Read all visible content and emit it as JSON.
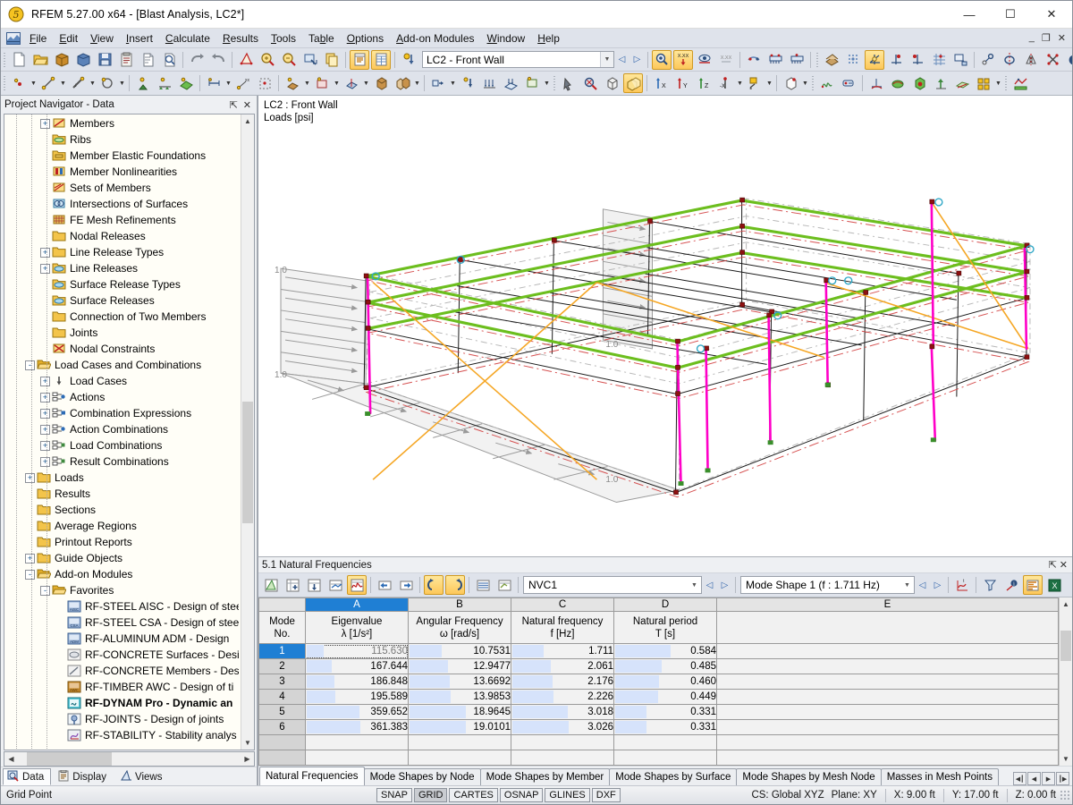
{
  "window": {
    "title": "RFEM 5.27.00 x64 - [Blast Analysis, LC2*]",
    "app_icon": "rfem-logo-icon",
    "minimize": "—",
    "maximize": "☐",
    "close": "✕",
    "mdi_minimize": "_",
    "mdi_restore": "❐",
    "mdi_close": "✕"
  },
  "menu": {
    "items": [
      {
        "label": "File",
        "mnemonic": "F"
      },
      {
        "label": "Edit",
        "mnemonic": "E"
      },
      {
        "label": "View",
        "mnemonic": "V"
      },
      {
        "label": "Insert",
        "mnemonic": "I"
      },
      {
        "label": "Calculate",
        "mnemonic": "C"
      },
      {
        "label": "Results",
        "mnemonic": "R"
      },
      {
        "label": "Tools",
        "mnemonic": "T"
      },
      {
        "label": "Table",
        "mnemonic": "b"
      },
      {
        "label": "Options",
        "mnemonic": "O"
      },
      {
        "label": "Add-on Modules",
        "mnemonic": "A"
      },
      {
        "label": "Window",
        "mnemonic": "W"
      },
      {
        "label": "Help",
        "mnemonic": "H"
      }
    ]
  },
  "toolbar_main": {
    "load_case_value": "LC2 - Front Wall",
    "load_case_placeholder": "Load case",
    "buttons": [
      "new-file-icon",
      "open-file-icon",
      "open-project-icon",
      "save-project-icon",
      "save-icon",
      "clipboard-icon",
      "print-preview-icon",
      "print-icon",
      "undo-icon",
      "redo-icon",
      "render-model-icon",
      "zoom-in-icon",
      "zoom-out-icon",
      "zoom-window-icon",
      "copy-icon",
      "table-display-icon",
      "table-grid-icon",
      "load-case-icon"
    ],
    "nav_prev": "◁",
    "nav_next": "▷",
    "right_buttons": [
      "show-support-icon",
      "show-loads-icon",
      "show-eye-icon",
      "show-values-icon",
      "member-hinge-icon",
      "support-view-1-icon",
      "support-view-2-icon",
      "render-surface-icon",
      "mesh-points-icon",
      "global-axes-icon",
      "axis-x-icon",
      "axis-y-icon",
      "mesh-grid-icon",
      "print-view-icon",
      "node-snap-icon",
      "rotate-icon",
      "mirror-icon",
      "delete-cross-icon",
      "info-icon",
      "measure-icon",
      "xls-export-icon"
    ]
  },
  "toolbar_second": {
    "buttons": [
      "node-icon",
      "line-icon",
      "member-icon",
      "opening-icon",
      "support-node-icon",
      "support-line-icon",
      "surface-icon",
      "dimension-icon",
      "text-icon",
      "select-region-icon",
      "solid-icon",
      "opening-2-icon",
      "cutting-plane-icon",
      "block-icon",
      "copy-block-icon",
      "result-beam-icon",
      "nodal-load-icon",
      "line-load-icon",
      "surface-load-icon",
      "free-load-icon",
      "imperfection-icon",
      "select-special-icon",
      "zoom-all-icon",
      "zoom-detail-icon",
      "view-box-icon",
      "view-3d-icon",
      "view-x-icon",
      "view-y-icon",
      "view-z-icon",
      "view-negx-icon",
      "render-mode-icon",
      "clipping-box-icon",
      "graph-icon",
      "results-table-icon",
      "deformation-icon",
      "surface-result-icon",
      "solid-result-icon",
      "member-result-icon",
      "smoothing-icon",
      "multi-window-icon",
      "result-diagram-icon"
    ]
  },
  "navigator": {
    "title": "Project Navigator - Data",
    "pin_icon": "pin-icon",
    "close_icon": "close-icon",
    "tree": [
      {
        "label": "Members",
        "icon": "members-icon",
        "indent": 3,
        "expander": "+"
      },
      {
        "label": "Ribs",
        "icon": "ribs-icon",
        "indent": 3,
        "expander": ""
      },
      {
        "label": "Member Elastic Foundations",
        "icon": "foundation-icon",
        "indent": 3,
        "expander": ""
      },
      {
        "label": "Member Nonlinearities",
        "icon": "nonlinearity-icon",
        "indent": 3,
        "expander": ""
      },
      {
        "label": "Sets of Members",
        "icon": "sets-icon",
        "indent": 3,
        "expander": ""
      },
      {
        "label": "Intersections of Surfaces",
        "icon": "intersections-icon",
        "indent": 3,
        "expander": ""
      },
      {
        "label": "FE Mesh Refinements",
        "icon": "mesh-refine-icon",
        "indent": 3,
        "expander": ""
      },
      {
        "label": "Nodal Releases",
        "icon": "folder-icon",
        "indent": 3,
        "expander": ""
      },
      {
        "label": "Line Release Types",
        "icon": "folder-icon",
        "indent": 3,
        "expander": "+"
      },
      {
        "label": "Line Releases",
        "icon": "folder-green-icon",
        "indent": 3,
        "expander": "+"
      },
      {
        "label": "Surface Release Types",
        "icon": "folder-green-icon",
        "indent": 3,
        "expander": ""
      },
      {
        "label": "Surface Releases",
        "icon": "folder-green-icon",
        "indent": 3,
        "expander": ""
      },
      {
        "label": "Connection of Two Members",
        "icon": "folder-icon",
        "indent": 3,
        "expander": ""
      },
      {
        "label": "Joints",
        "icon": "folder-icon",
        "indent": 3,
        "expander": ""
      },
      {
        "label": "Nodal Constraints",
        "icon": "constraints-icon",
        "indent": 3,
        "expander": ""
      },
      {
        "label": "Load Cases and Combinations",
        "icon": "folder-open-icon",
        "indent": 2,
        "expander": "-"
      },
      {
        "label": "Load Cases",
        "icon": "loadcase-icon",
        "indent": 3,
        "expander": "+"
      },
      {
        "label": "Actions",
        "icon": "action-icon",
        "indent": 3,
        "expander": "+"
      },
      {
        "label": "Combination Expressions",
        "icon": "comb-expr-icon",
        "indent": 3,
        "expander": "+"
      },
      {
        "label": "Action Combinations",
        "icon": "action-comb-icon",
        "indent": 3,
        "expander": "+"
      },
      {
        "label": "Load Combinations",
        "icon": "load-comb-icon",
        "indent": 3,
        "expander": "+"
      },
      {
        "label": "Result Combinations",
        "icon": "result-comb-icon",
        "indent": 3,
        "expander": "+"
      },
      {
        "label": "Loads",
        "icon": "folder-icon",
        "indent": 2,
        "expander": "+"
      },
      {
        "label": "Results",
        "icon": "folder-icon",
        "indent": 2,
        "expander": ""
      },
      {
        "label": "Sections",
        "icon": "folder-icon",
        "indent": 2,
        "expander": ""
      },
      {
        "label": "Average Regions",
        "icon": "folder-icon",
        "indent": 2,
        "expander": ""
      },
      {
        "label": "Printout Reports",
        "icon": "folder-icon",
        "indent": 2,
        "expander": ""
      },
      {
        "label": "Guide Objects",
        "icon": "folder-icon",
        "indent": 2,
        "expander": "+"
      },
      {
        "label": "Add-on Modules",
        "icon": "folder-open-icon",
        "indent": 2,
        "expander": "-"
      },
      {
        "label": "Favorites",
        "icon": "folder-open-icon",
        "indent": 3,
        "expander": "-"
      },
      {
        "label": "RF-STEEL AISC - Design of stee",
        "icon": "aisc-icon",
        "indent": 4,
        "expander": ""
      },
      {
        "label": "RF-STEEL CSA - Design of steel",
        "icon": "csa-icon",
        "indent": 4,
        "expander": ""
      },
      {
        "label": "RF-ALUMINUM ADM - Design",
        "icon": "adm-icon",
        "indent": 4,
        "expander": ""
      },
      {
        "label": "RF-CONCRETE Surfaces - Desig",
        "icon": "concrete-surf-icon",
        "indent": 4,
        "expander": ""
      },
      {
        "label": "RF-CONCRETE Members - Des",
        "icon": "concrete-mem-icon",
        "indent": 4,
        "expander": ""
      },
      {
        "label": "RF-TIMBER AWC - Design of ti",
        "icon": "awc-icon",
        "indent": 4,
        "expander": ""
      },
      {
        "label": "RF-DYNAM Pro - Dynamic an",
        "icon": "dynam-icon",
        "indent": 4,
        "expander": "",
        "bold": true
      },
      {
        "label": "RF-JOINTS - Design of joints",
        "icon": "joints-icon",
        "indent": 4,
        "expander": ""
      },
      {
        "label": "RF-STABILITY - Stability analys",
        "icon": "stability-icon",
        "indent": 4,
        "expander": ""
      }
    ],
    "tabs": [
      {
        "label": "Data",
        "icon": "data-icon",
        "selected": true
      },
      {
        "label": "Display",
        "icon": "display-icon",
        "selected": false
      },
      {
        "label": "Views",
        "icon": "views-icon",
        "selected": false
      }
    ]
  },
  "viewport": {
    "label_line1": "LC2 : Front Wall",
    "label_line2": "Loads [psi]",
    "load_values": [
      "1.0",
      "1.0",
      "1.0",
      "1.0"
    ],
    "colors": {
      "green_beam": "#6cbe1e",
      "magenta_member": "#ff00c8",
      "orange_brace": "#f5a623",
      "node_red": "#8e1010",
      "load_gray": "#9a9a9a",
      "surface_fill": "#eeeeee"
    }
  },
  "table_panel": {
    "title": "5.1 Natural Frequencies",
    "pin_icon": "pin-icon",
    "close_icon": "close-icon",
    "toolbar_buttons": [
      "table-filter-icon",
      "table-insert-icon",
      "table-import-icon",
      "table-edit-icon",
      "table-chart-icon",
      "table-prev-icon",
      "table-next-icon",
      "table-undo-icon",
      "table-redo-icon",
      "table-view-icon",
      "table-print-icon"
    ],
    "toolbar_right_buttons": [
      "table-graph-icon",
      "table-filter2-icon",
      "table-info-icon",
      "table-color-icon",
      "table-excel-icon"
    ],
    "combo_loadcase": "NVC1",
    "combo_loadcase_placeholder": "Load case",
    "combo_modeshape": "Mode Shape 1 (f : 1.711 Hz)",
    "combo_modeshape_placeholder": "Mode shape",
    "nav_prev": "◁",
    "nav_next": "▷",
    "row_header_label_line1": "Mode",
    "row_header_label_line2": "No.",
    "column_letters": [
      "A",
      "B",
      "C",
      "D",
      "E"
    ],
    "selected_column": "A",
    "columns": [
      {
        "title": "Eigenvalue",
        "unit": "λ [1/s²]"
      },
      {
        "title": "Angular Frequency",
        "unit": "ω [rad/s]"
      },
      {
        "title": "Natural frequency",
        "unit": "f [Hz]"
      },
      {
        "title": "Natural period",
        "unit": "T [s]"
      },
      {
        "title": "",
        "unit": ""
      }
    ],
    "rows": [
      {
        "no": "1",
        "eigenvalue": "115.630",
        "angular": "10.7531",
        "frequency": "1.711",
        "period": "0.584",
        "selected": true
      },
      {
        "no": "2",
        "eigenvalue": "167.644",
        "angular": "12.9477",
        "frequency": "2.061",
        "period": "0.485",
        "selected": false
      },
      {
        "no": "3",
        "eigenvalue": "186.848",
        "angular": "13.6692",
        "frequency": "2.176",
        "period": "0.460",
        "selected": false
      },
      {
        "no": "4",
        "eigenvalue": "195.589",
        "angular": "13.9853",
        "frequency": "2.226",
        "period": "0.449",
        "selected": false
      },
      {
        "no": "5",
        "eigenvalue": "359.652",
        "angular": "18.9645",
        "frequency": "3.018",
        "period": "0.331",
        "selected": false
      },
      {
        "no": "6",
        "eigenvalue": "361.383",
        "angular": "19.0101",
        "frequency": "3.026",
        "period": "0.331",
        "selected": false
      }
    ],
    "tabs": [
      {
        "label": "Natural Frequencies",
        "selected": true
      },
      {
        "label": "Mode Shapes by Node",
        "selected": false
      },
      {
        "label": "Mode Shapes by Member",
        "selected": false
      },
      {
        "label": "Mode Shapes by Surface",
        "selected": false
      },
      {
        "label": "Mode Shapes by Mesh Node",
        "selected": false
      },
      {
        "label": "Masses in Mesh Points",
        "selected": false
      }
    ],
    "tab_nav": [
      "◀┃",
      "◀",
      "▶",
      "┃▶"
    ]
  },
  "statusbar": {
    "message": "Grid Point",
    "toggles": [
      {
        "label": "SNAP",
        "on": false
      },
      {
        "label": "GRID",
        "on": true
      },
      {
        "label": "CARTES",
        "on": false
      },
      {
        "label": "OSNAP",
        "on": false
      },
      {
        "label": "GLINES",
        "on": false
      },
      {
        "label": "DXF",
        "on": false
      }
    ],
    "cs": "CS: Global XYZ",
    "plane": "Plane: XY",
    "coord_x": "X: 9.00 ft",
    "coord_y": "Y: 17.00 ft",
    "coord_z": "Z: 0.00 ft"
  }
}
